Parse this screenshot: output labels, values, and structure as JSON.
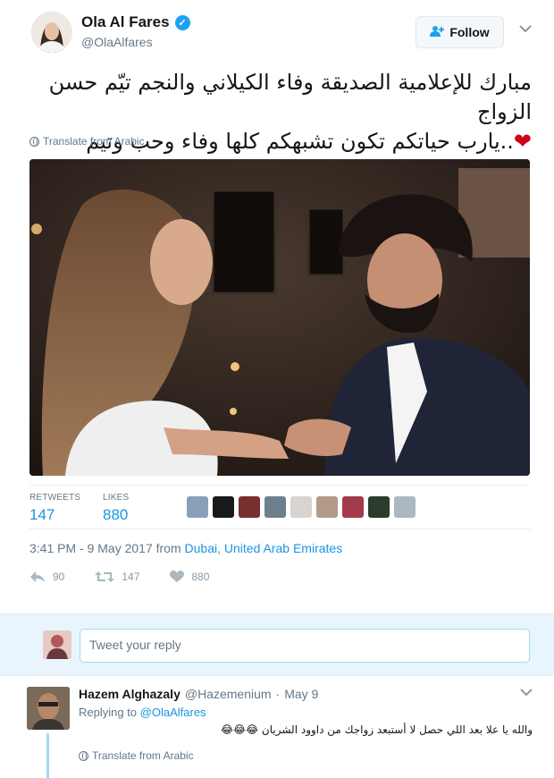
{
  "tweet": {
    "author_name": "Ola Al Fares",
    "author_handle": "@OlaAlfares",
    "follow_label": "Follow",
    "text_line1": "مبارك للإعلامية الصديقة وفاء الكيلاني والنجم تيّم حسن الزواج",
    "text_line2": "..يارب حياتكم تكون تشبهكم كلها وفاء وحب  وتيم",
    "heart": "❤",
    "translate_label": "Translate from Arabic",
    "retweets_label": "RETWEETS",
    "retweets_count": "147",
    "likes_label": "LIKES",
    "likes_count": "880",
    "time_date": "3:41 PM - 9 May 2017 from ",
    "location_city": "Dubai",
    "location_sep": ", ",
    "location_country": "United Arab Emirates",
    "action_reply_count": "90",
    "action_retweet_count": "147",
    "action_like_count": "880"
  },
  "composer": {
    "placeholder": "Tweet your reply"
  },
  "reply": {
    "name": "Hazem Alghazaly",
    "handle": "@Hazemenium",
    "separator": "·",
    "time": "May 9",
    "replying_prefix": "Replying to ",
    "replying_to": "@OlaAlfares",
    "text": "والله  يا علا بعد اللي حصل لا أستبعد زواجك من داوود الشريان 😂😂😂",
    "translate_label": "Translate from Arabic"
  },
  "colors": {
    "accent": "#1da1f2",
    "link": "#1b95e0",
    "muted": "#657786",
    "heart": "#d0021b",
    "reply_bg": "#e8f5fd"
  }
}
